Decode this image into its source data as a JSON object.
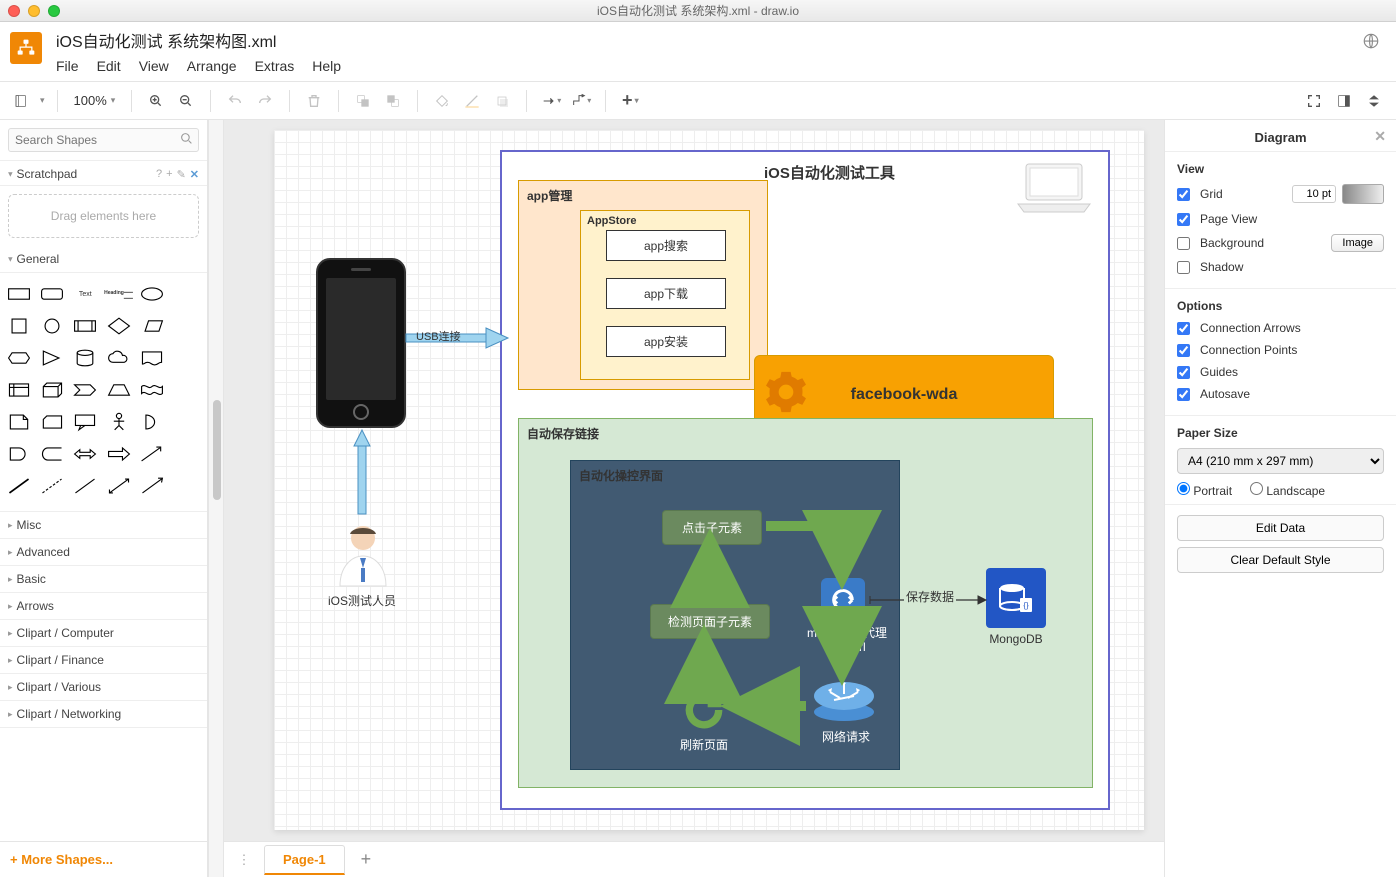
{
  "window": {
    "title": "iOS自动化测试 系统架构.xml - draw.io"
  },
  "file": {
    "name": "iOS自动化测试 系统架构图.xml"
  },
  "menu": {
    "file": "File",
    "edit": "Edit",
    "view": "View",
    "arrange": "Arrange",
    "extras": "Extras",
    "help": "Help"
  },
  "toolbar": {
    "zoom": "100%"
  },
  "sidebar": {
    "search_placeholder": "Search Shapes",
    "scratchpad": "Scratchpad",
    "drop_hint": "Drag elements here",
    "sections": {
      "general": "General",
      "misc": "Misc",
      "advanced": "Advanced",
      "basic": "Basic",
      "arrows": "Arrows",
      "clipart_computer": "Clipart / Computer",
      "clipart_finance": "Clipart / Finance",
      "clipart_various": "Clipart / Various",
      "clipart_networking": "Clipart / Networking"
    },
    "more_shapes": "+ More Shapes..."
  },
  "tabs": {
    "page1": "Page-1"
  },
  "right": {
    "header": "Diagram",
    "view": {
      "title": "View",
      "grid": "Grid",
      "grid_value": "10 pt",
      "page_view": "Page View",
      "background": "Background",
      "image_btn": "Image",
      "shadow": "Shadow"
    },
    "options": {
      "title": "Options",
      "conn_arrows": "Connection Arrows",
      "conn_points": "Connection Points",
      "guides": "Guides",
      "autosave": "Autosave"
    },
    "paper": {
      "title": "Paper Size",
      "value": "A4 (210 mm x 297 mm)",
      "portrait": "Portrait",
      "landscape": "Landscape"
    },
    "edit_data": "Edit Data",
    "clear_style": "Clear Default Style"
  },
  "diagram": {
    "main_title": "iOS自动化测试工具",
    "usb": "USB连接",
    "tester": "iOS测试人员",
    "app_mgmt": {
      "title": "app管理",
      "store": "AppStore",
      "search": "app搜索",
      "download": "app下载",
      "install": "app安装"
    },
    "wda": "facebook-wda",
    "auto_save": "自动保存链接",
    "ui_panel": "自动化操控界面",
    "click_elem": "点击子元素",
    "detect_elem": "检测页面子元素",
    "refresh": "刷新页面",
    "net_req": "网络请求",
    "mitmdump": "mitmdump代理保存url",
    "save_data": "保存数据",
    "mongodb": "MongoDB"
  }
}
